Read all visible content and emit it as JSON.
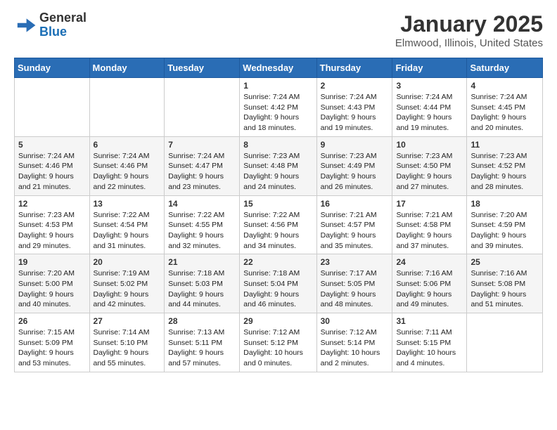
{
  "header": {
    "logo_general": "General",
    "logo_blue": "Blue",
    "month_title": "January 2025",
    "location": "Elmwood, Illinois, United States"
  },
  "days_of_week": [
    "Sunday",
    "Monday",
    "Tuesday",
    "Wednesday",
    "Thursday",
    "Friday",
    "Saturday"
  ],
  "weeks": [
    [
      {
        "day": "",
        "info": ""
      },
      {
        "day": "",
        "info": ""
      },
      {
        "day": "",
        "info": ""
      },
      {
        "day": "1",
        "info": "Sunrise: 7:24 AM\nSunset: 4:42 PM\nDaylight: 9 hours\nand 18 minutes."
      },
      {
        "day": "2",
        "info": "Sunrise: 7:24 AM\nSunset: 4:43 PM\nDaylight: 9 hours\nand 19 minutes."
      },
      {
        "day": "3",
        "info": "Sunrise: 7:24 AM\nSunset: 4:44 PM\nDaylight: 9 hours\nand 19 minutes."
      },
      {
        "day": "4",
        "info": "Sunrise: 7:24 AM\nSunset: 4:45 PM\nDaylight: 9 hours\nand 20 minutes."
      }
    ],
    [
      {
        "day": "5",
        "info": "Sunrise: 7:24 AM\nSunset: 4:46 PM\nDaylight: 9 hours\nand 21 minutes."
      },
      {
        "day": "6",
        "info": "Sunrise: 7:24 AM\nSunset: 4:46 PM\nDaylight: 9 hours\nand 22 minutes."
      },
      {
        "day": "7",
        "info": "Sunrise: 7:24 AM\nSunset: 4:47 PM\nDaylight: 9 hours\nand 23 minutes."
      },
      {
        "day": "8",
        "info": "Sunrise: 7:23 AM\nSunset: 4:48 PM\nDaylight: 9 hours\nand 24 minutes."
      },
      {
        "day": "9",
        "info": "Sunrise: 7:23 AM\nSunset: 4:49 PM\nDaylight: 9 hours\nand 26 minutes."
      },
      {
        "day": "10",
        "info": "Sunrise: 7:23 AM\nSunset: 4:50 PM\nDaylight: 9 hours\nand 27 minutes."
      },
      {
        "day": "11",
        "info": "Sunrise: 7:23 AM\nSunset: 4:52 PM\nDaylight: 9 hours\nand 28 minutes."
      }
    ],
    [
      {
        "day": "12",
        "info": "Sunrise: 7:23 AM\nSunset: 4:53 PM\nDaylight: 9 hours\nand 29 minutes."
      },
      {
        "day": "13",
        "info": "Sunrise: 7:22 AM\nSunset: 4:54 PM\nDaylight: 9 hours\nand 31 minutes."
      },
      {
        "day": "14",
        "info": "Sunrise: 7:22 AM\nSunset: 4:55 PM\nDaylight: 9 hours\nand 32 minutes."
      },
      {
        "day": "15",
        "info": "Sunrise: 7:22 AM\nSunset: 4:56 PM\nDaylight: 9 hours\nand 34 minutes."
      },
      {
        "day": "16",
        "info": "Sunrise: 7:21 AM\nSunset: 4:57 PM\nDaylight: 9 hours\nand 35 minutes."
      },
      {
        "day": "17",
        "info": "Sunrise: 7:21 AM\nSunset: 4:58 PM\nDaylight: 9 hours\nand 37 minutes."
      },
      {
        "day": "18",
        "info": "Sunrise: 7:20 AM\nSunset: 4:59 PM\nDaylight: 9 hours\nand 39 minutes."
      }
    ],
    [
      {
        "day": "19",
        "info": "Sunrise: 7:20 AM\nSunset: 5:00 PM\nDaylight: 9 hours\nand 40 minutes."
      },
      {
        "day": "20",
        "info": "Sunrise: 7:19 AM\nSunset: 5:02 PM\nDaylight: 9 hours\nand 42 minutes."
      },
      {
        "day": "21",
        "info": "Sunrise: 7:18 AM\nSunset: 5:03 PM\nDaylight: 9 hours\nand 44 minutes."
      },
      {
        "day": "22",
        "info": "Sunrise: 7:18 AM\nSunset: 5:04 PM\nDaylight: 9 hours\nand 46 minutes."
      },
      {
        "day": "23",
        "info": "Sunrise: 7:17 AM\nSunset: 5:05 PM\nDaylight: 9 hours\nand 48 minutes."
      },
      {
        "day": "24",
        "info": "Sunrise: 7:16 AM\nSunset: 5:06 PM\nDaylight: 9 hours\nand 49 minutes."
      },
      {
        "day": "25",
        "info": "Sunrise: 7:16 AM\nSunset: 5:08 PM\nDaylight: 9 hours\nand 51 minutes."
      }
    ],
    [
      {
        "day": "26",
        "info": "Sunrise: 7:15 AM\nSunset: 5:09 PM\nDaylight: 9 hours\nand 53 minutes."
      },
      {
        "day": "27",
        "info": "Sunrise: 7:14 AM\nSunset: 5:10 PM\nDaylight: 9 hours\nand 55 minutes."
      },
      {
        "day": "28",
        "info": "Sunrise: 7:13 AM\nSunset: 5:11 PM\nDaylight: 9 hours\nand 57 minutes."
      },
      {
        "day": "29",
        "info": "Sunrise: 7:12 AM\nSunset: 5:12 PM\nDaylight: 10 hours\nand 0 minutes."
      },
      {
        "day": "30",
        "info": "Sunrise: 7:12 AM\nSunset: 5:14 PM\nDaylight: 10 hours\nand 2 minutes."
      },
      {
        "day": "31",
        "info": "Sunrise: 7:11 AM\nSunset: 5:15 PM\nDaylight: 10 hours\nand 4 minutes."
      },
      {
        "day": "",
        "info": ""
      }
    ]
  ]
}
